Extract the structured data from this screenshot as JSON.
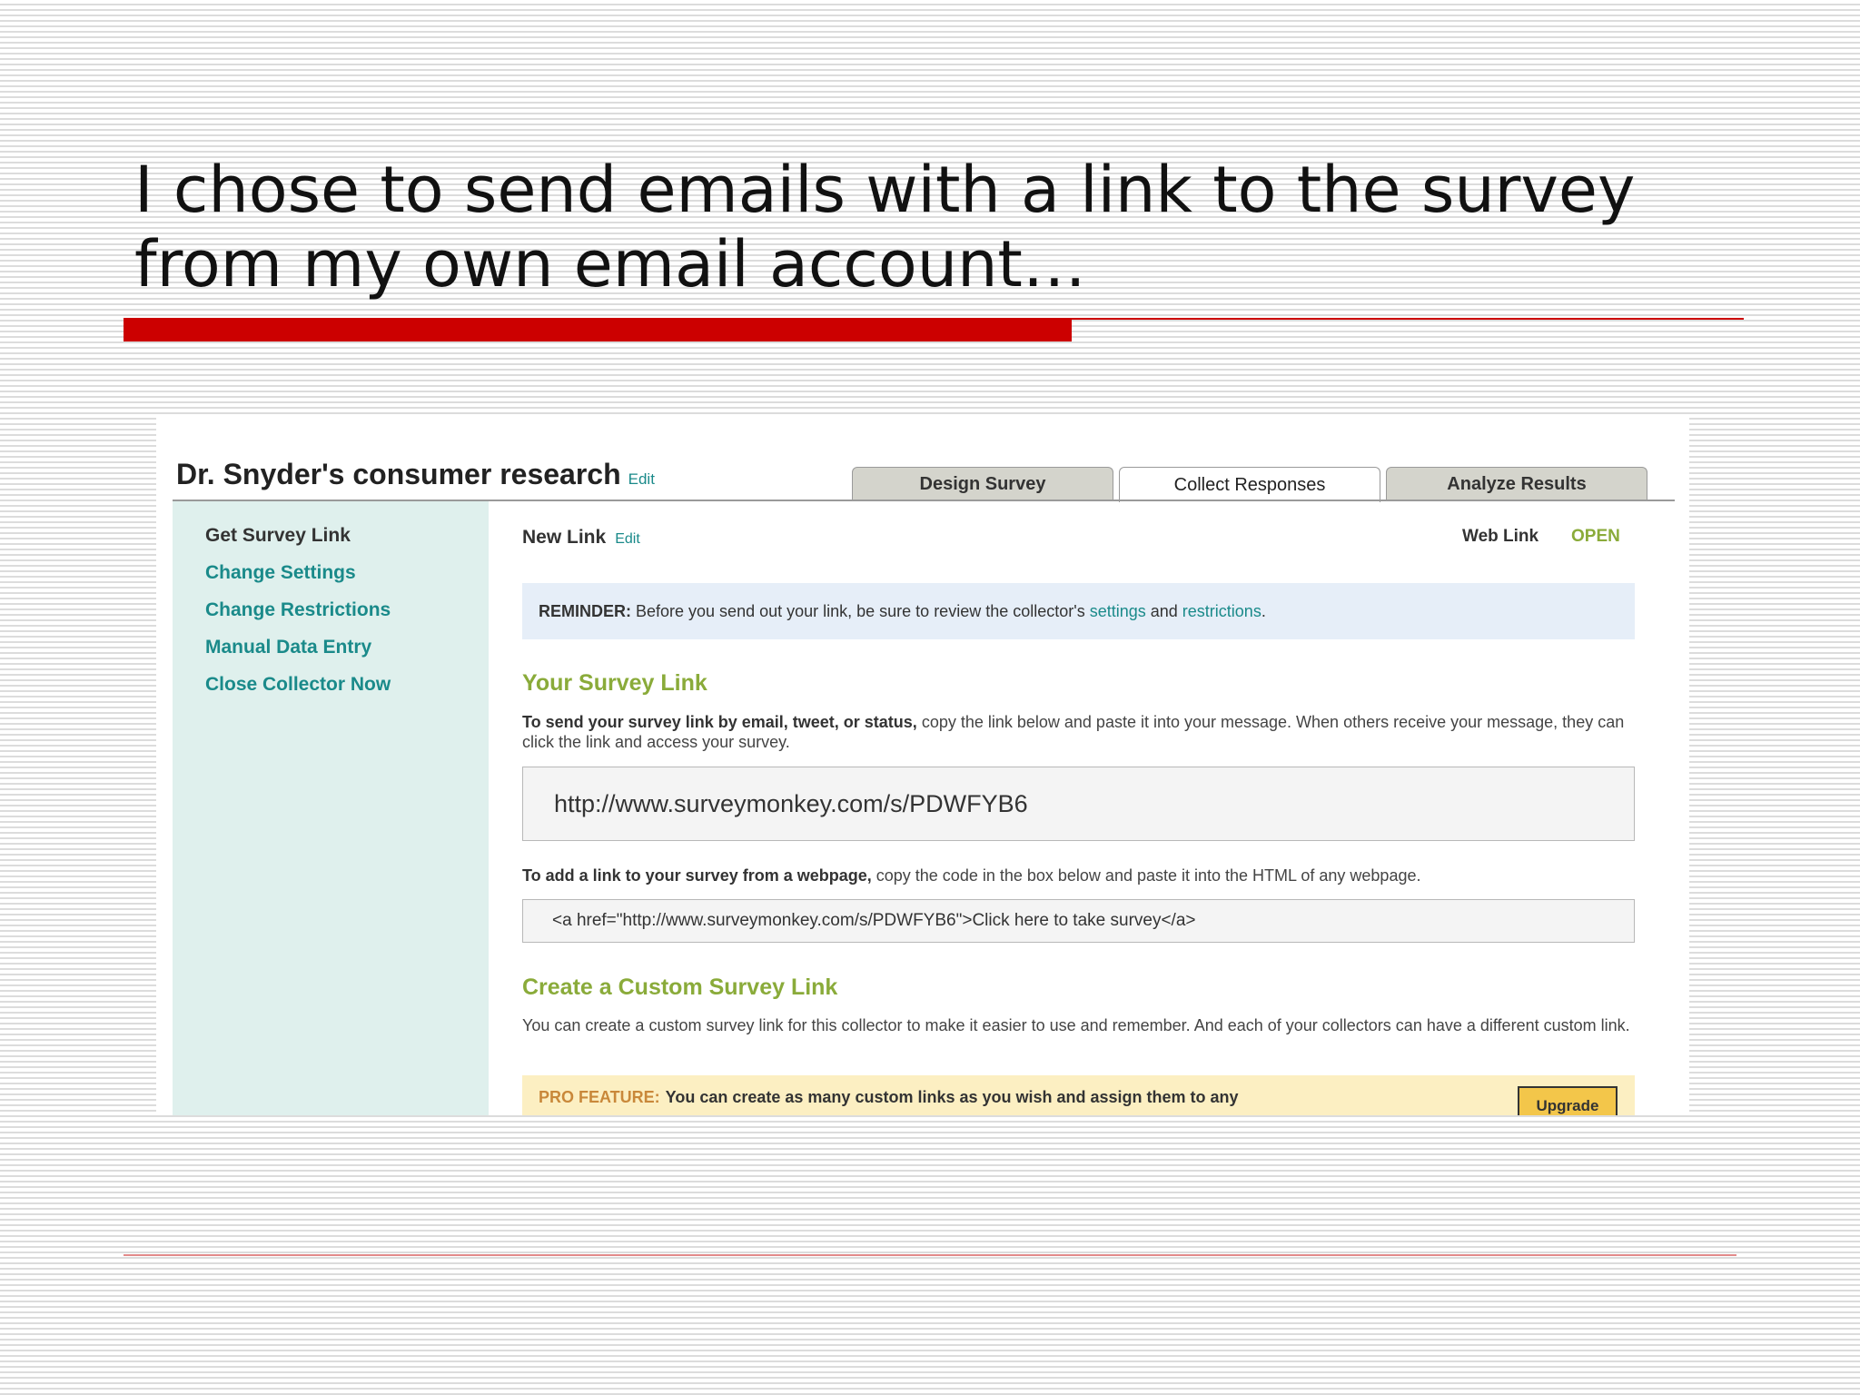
{
  "slide": {
    "title_line1": "I chose to send emails with a link to the survey",
    "title_line2": "from my own email account…"
  },
  "screenshot": {
    "survey_title": "Dr. Snyder's consumer research",
    "survey_title_edit": "Edit",
    "tabs": [
      {
        "label": "Design Survey",
        "active": false
      },
      {
        "label": "Collect Responses",
        "active": true
      },
      {
        "label": "Analyze Results",
        "active": false
      }
    ],
    "sidebar": {
      "items": [
        {
          "label": "Get Survey Link",
          "current": true
        },
        {
          "label": "Change Settings"
        },
        {
          "label": "Change Restrictions"
        },
        {
          "label": "Manual Data Entry"
        },
        {
          "label": "Close Collector Now"
        }
      ]
    },
    "main": {
      "collector_name": "New Link",
      "collector_edit": "Edit",
      "collector_type": "Web Link",
      "collector_status": "OPEN",
      "reminder": {
        "label": "REMINDER:",
        "text_before": "Before you send out your link, be sure to review the collector's",
        "link_settings": "settings",
        "text_and": "and",
        "link_restrictions": "restrictions",
        "text_end": "."
      },
      "survey_link_heading": "Your Survey Link",
      "survey_link_intro_bold": "To send your survey link by email, tweet, or status,",
      "survey_link_intro": "copy the link below and paste it into your message. When others receive your message, they can click the link and access your survey.",
      "survey_url": "http://www.surveymonkey.com/s/PDWFYB6",
      "webpage_intro_bold": "To add a link to your survey from a webpage,",
      "webpage_intro": "copy the code in the box below and paste it into the HTML of any webpage.",
      "embed_code": "<a href=\"http://www.surveymonkey.com/s/PDWFYB6\">Click here to take survey</a>",
      "custom_heading": "Create a Custom Survey Link",
      "custom_text": "You can create a custom survey link for this collector to make it easier to use and remember. And each of your collectors can have a different custom link.",
      "pro": {
        "label": "PRO FEATURE:",
        "text": "You can create as many custom links as you wish and assign them to any",
        "upgrade_label": "Upgrade"
      }
    }
  },
  "colors": {
    "accent_red": "#cc0000",
    "link_teal": "#1a8a8a",
    "heading_green": "#8aab3a",
    "sidebar_bg": "#dff0ed"
  }
}
